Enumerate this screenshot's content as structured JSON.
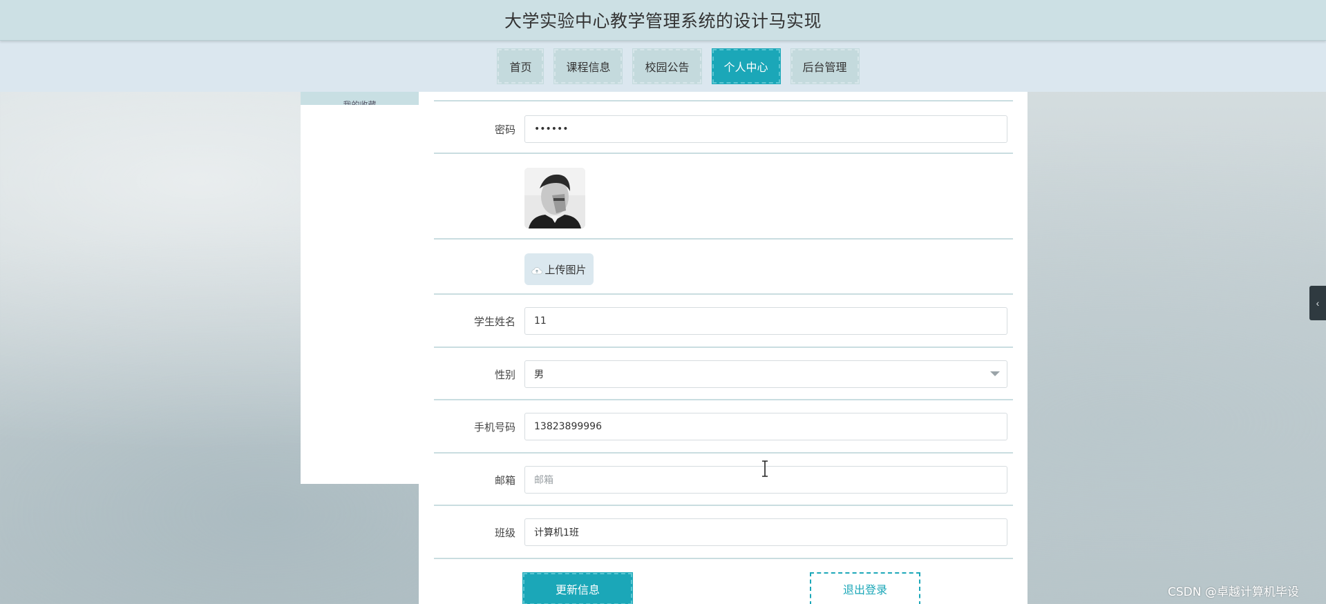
{
  "header": {
    "title": "大学实验中心教学管理系统的设计马实现"
  },
  "nav": {
    "items": [
      {
        "label": "首页",
        "active": false
      },
      {
        "label": "课程信息",
        "active": false
      },
      {
        "label": "校园公告",
        "active": false
      },
      {
        "label": "个人中心",
        "active": true
      },
      {
        "label": "后台管理",
        "active": false
      }
    ]
  },
  "sidebar": {
    "items": [
      {
        "label": "我的收藏"
      }
    ]
  },
  "form": {
    "password": {
      "label": "密码",
      "value": "••••••"
    },
    "upload": {
      "label": "上传图片"
    },
    "name": {
      "label": "学生姓名",
      "value": "11"
    },
    "gender": {
      "label": "性别",
      "value": "男"
    },
    "phone": {
      "label": "手机号码",
      "value": "13823899996"
    },
    "email": {
      "label": "邮箱",
      "value": "",
      "placeholder": "邮箱"
    },
    "class": {
      "label": "班级",
      "value": "计算机1班"
    }
  },
  "actions": {
    "update_label": "更新信息",
    "logout_label": "退出登录"
  },
  "watermark": {
    "text": "CSDN @卓越计算机毕设"
  },
  "colors": {
    "accent": "#1ba7b8",
    "header_bg": "#cce0e4",
    "nav_bg": "#dbe7ef",
    "nav_item_bg": "#c4dadd",
    "divider": "#c9dde0"
  },
  "icons": {
    "upload": "cloud-upload-icon",
    "dropdown": "chevron-down-icon",
    "side_toggle": "chevron-left-icon"
  }
}
